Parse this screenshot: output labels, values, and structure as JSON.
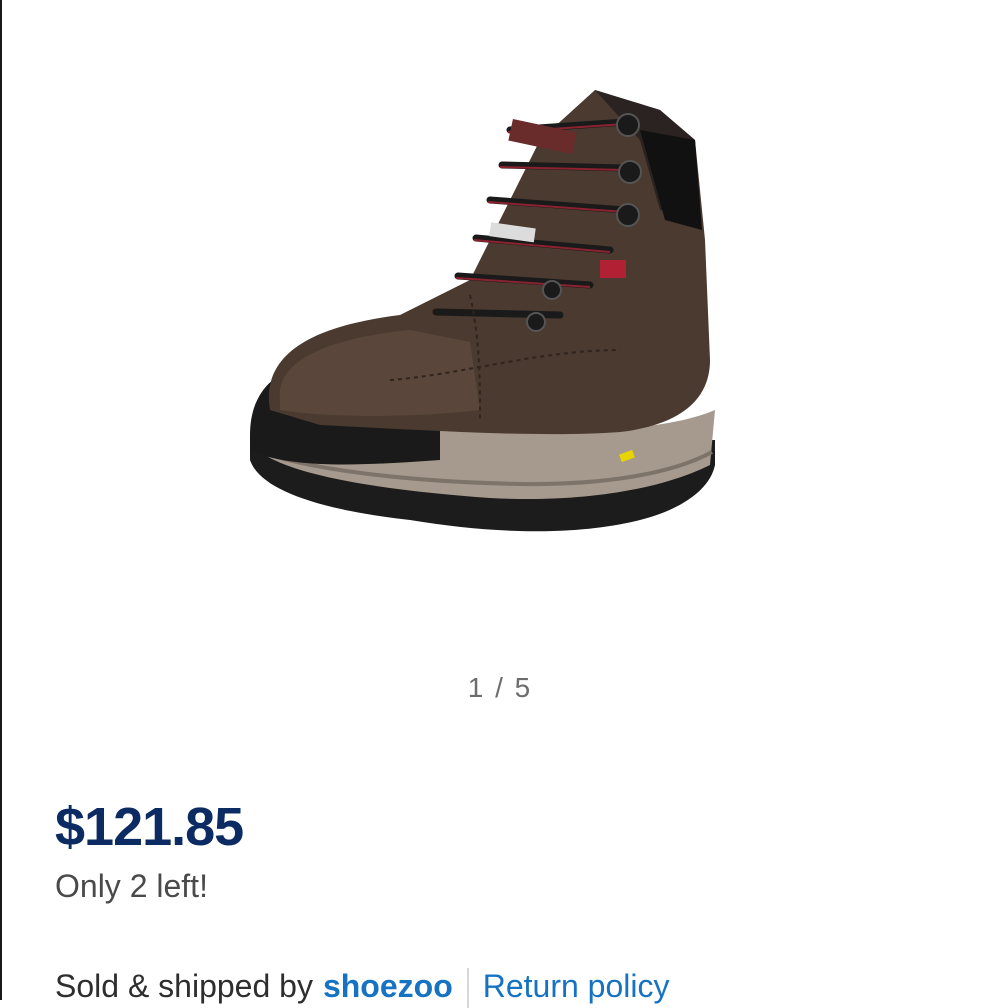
{
  "gallery": {
    "image_alt": "Brown leather work boot with black laces and red accents",
    "current_page": 1,
    "total_pages": 5,
    "page_indicator": "1 / 5"
  },
  "product": {
    "price": "$121.85",
    "stock_note": "Only 2 left!"
  },
  "seller": {
    "prefix": "Sold & shipped by",
    "name": "shoezoo",
    "return_policy_label": "Return policy"
  },
  "colors": {
    "price": "#0d2b63",
    "link": "#1673c3",
    "muted_text": "#6d6d6d",
    "body_text": "#4a4a4a"
  }
}
